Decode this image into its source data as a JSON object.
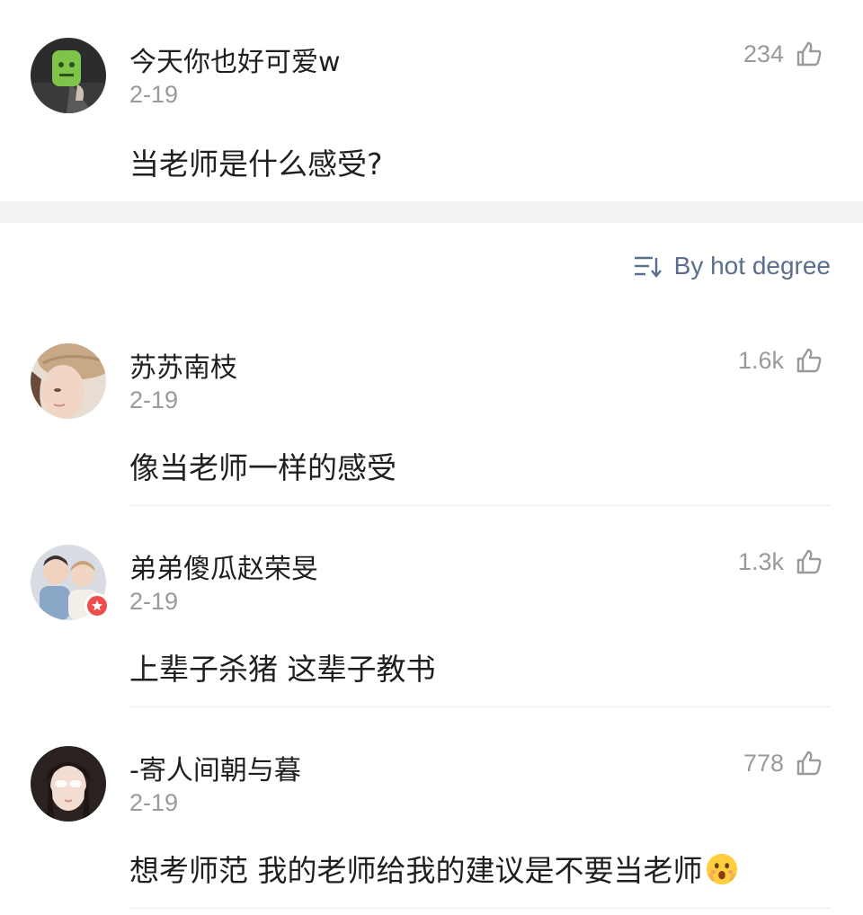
{
  "post": {
    "username": "今天你也好可爱w",
    "date": "2-19",
    "text": "当老师是什么感受?",
    "likes": "234",
    "avatar_icon": "green-mask-avatar"
  },
  "sort": {
    "label": "By hot degree",
    "icon": "sort-icon"
  },
  "comments": [
    {
      "username": "苏苏南枝",
      "date": "2-19",
      "text": "像当老师一样的感受",
      "likes": "1.6k",
      "avatar_icon": "straw-hat-avatar"
    },
    {
      "username": "弟弟傻瓜赵荣旻",
      "date": "2-19",
      "text": "上辈子杀猪 这辈子教书",
      "likes": "1.3k",
      "avatar_icon": "two-people-avatar",
      "badge": "red-star-badge"
    },
    {
      "username": "-寄人间朝与暮",
      "date": "2-19",
      "text": "想考师范 我的老师给我的建议是不要当老师",
      "likes": "778",
      "avatar_icon": "girl-portrait-avatar",
      "emoji": "shocked-face-emoji"
    }
  ],
  "colors": {
    "accent": "#5b6e8d",
    "secondary_text": "#9a9a9a",
    "primary_text": "#1f1f1f",
    "band": "#f2f2f2",
    "badge": "#f04c4c"
  }
}
